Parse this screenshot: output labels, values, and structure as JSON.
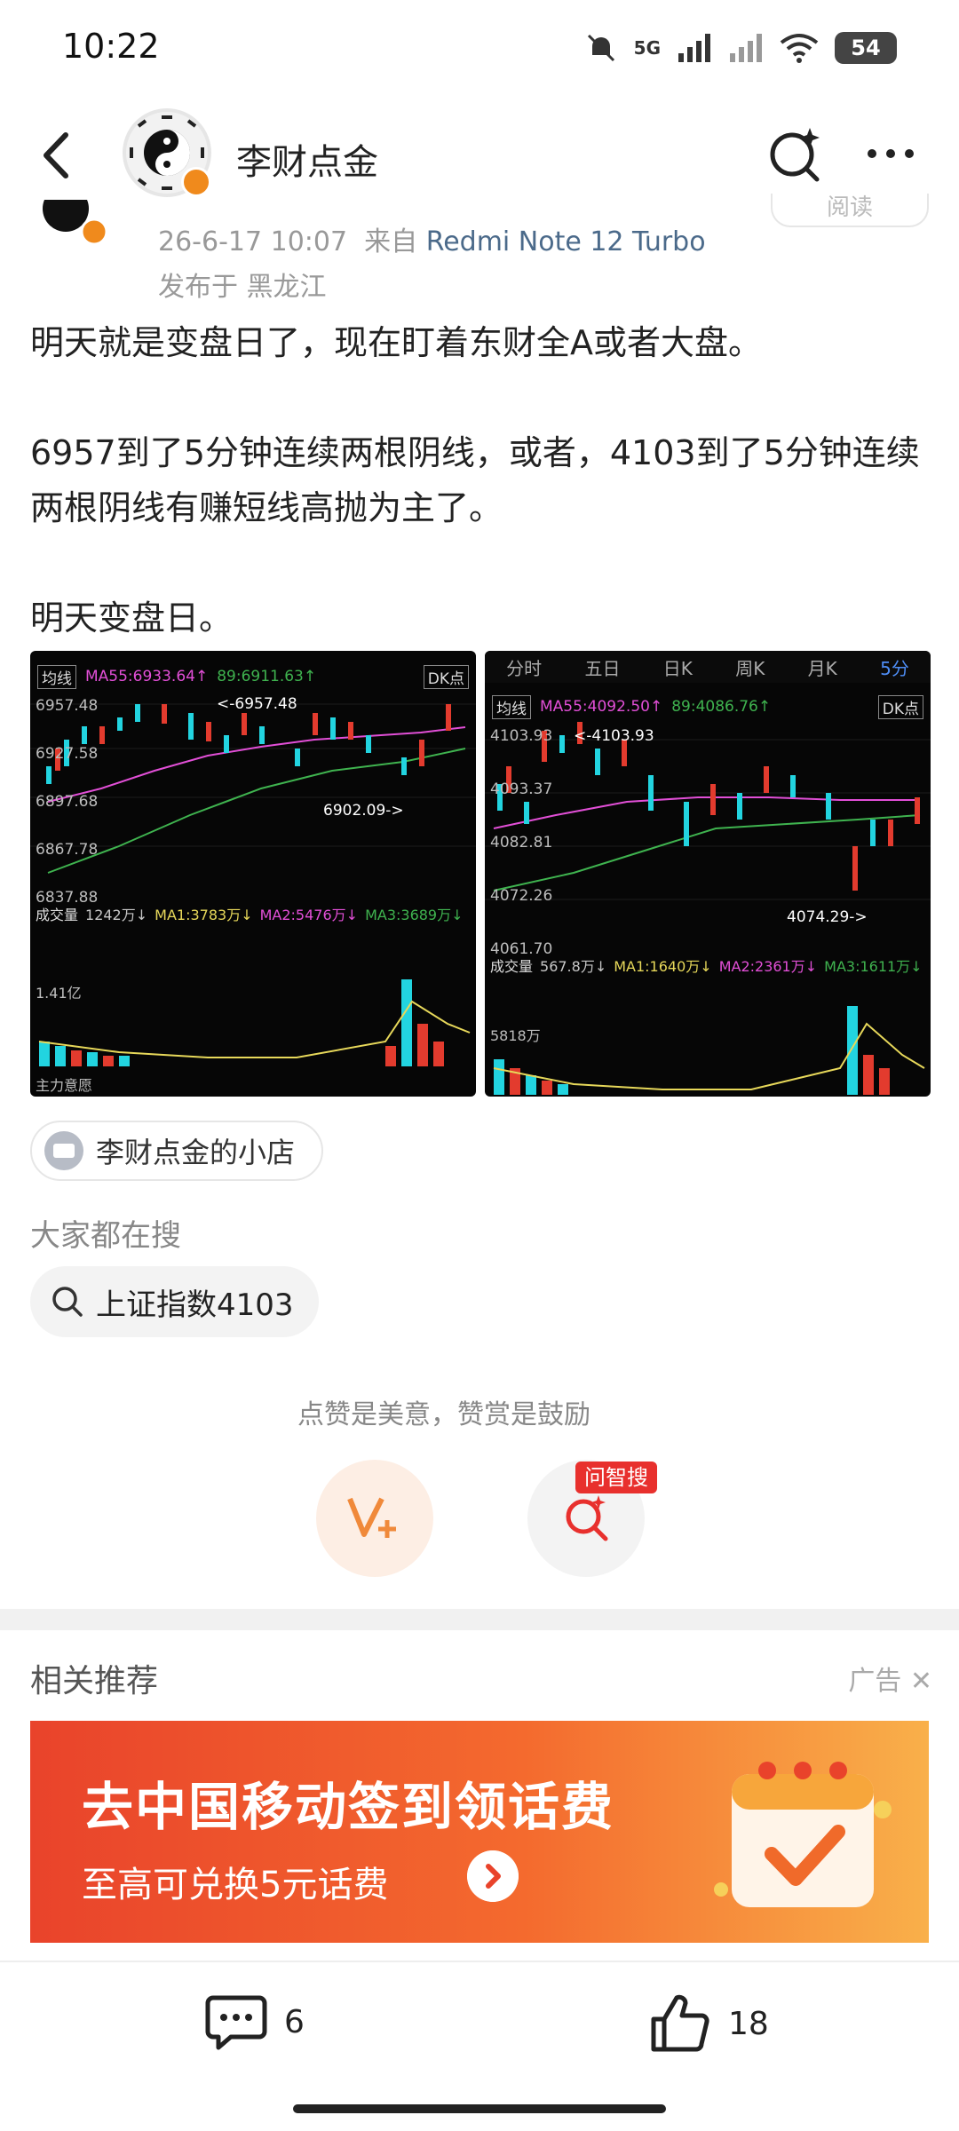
{
  "status": {
    "time": "10:22",
    "network": "5G",
    "battery": "54"
  },
  "header": {
    "title": "李财点金"
  },
  "meta": {
    "date": "26-6-17 10:07",
    "from_prefix": "来自",
    "device": "Redmi Note 12 Turbo",
    "published_in": "发布于 黑龙江",
    "read_label": "阅读"
  },
  "post": {
    "para1": "明天就是变盘日了，现在盯着东财全A或者大盘。",
    "para2": "6957到了5分钟连续两根阴线，或者，4103到了5分钟连续两根阴线有赚短线高抛为主了。",
    "para3": "明天变盘日。"
  },
  "charts": {
    "left": {
      "ma_tag": "均线",
      "ma55": "MA55:6933.64↑",
      "ma89": "89:6911.63↑",
      "dk": "DK点",
      "prices": [
        "6957.48",
        "6927.58",
        "6897.68",
        "6867.78",
        "6837.88"
      ],
      "high_annot": "<-6957.48",
      "low_annot": "6902.09->",
      "vol_tag": "成交量",
      "vol": "1242万↓",
      "vol_ma1": "MA1:3783万↓",
      "vol_ma2": "MA2:5476万↓",
      "vol_ma3": "MA3:3689万↓",
      "vol_scale": "1.41亿",
      "main_force": "主力意愿"
    },
    "right": {
      "tabs": [
        "分时",
        "五日",
        "日K",
        "周K",
        "月K",
        "5分"
      ],
      "active_tab": "5分",
      "ma_tag": "均线",
      "ma55": "MA55:4092.50↑",
      "ma89": "89:4086.76↑",
      "dk": "DK点",
      "prices": [
        "4103.93",
        "4093.37",
        "4082.81",
        "4072.26",
        "4061.70"
      ],
      "high_annot": "<-4103.93",
      "low_annot": "4074.29->",
      "vol_tag": "成交量",
      "vol": "567.8万↓",
      "vol_ma1": "MA1:1640万↓",
      "vol_ma2": "MA2:2361万↓",
      "vol_ma3": "MA3:1611万↓",
      "vol_scale": "5818万"
    }
  },
  "shop": {
    "label": "李财点金的小店"
  },
  "searching": {
    "title": "大家都在搜",
    "query": "上证指数4103"
  },
  "engage": {
    "encourage": "点赞是美意，赞赏是鼓励",
    "ask_badge": "问智搜"
  },
  "related": {
    "title": "相关推荐",
    "ad_tag": "广告"
  },
  "ad": {
    "headline": "去中国移动签到领话费",
    "sub": "至高可兑换5元话费"
  },
  "bottom": {
    "comments": "6",
    "likes": "18"
  }
}
